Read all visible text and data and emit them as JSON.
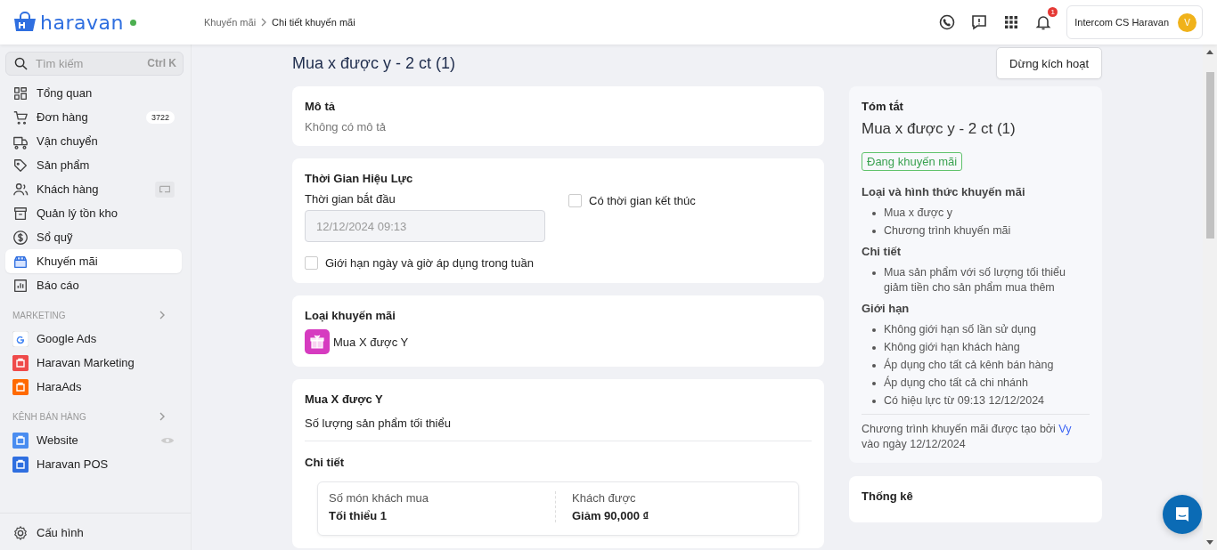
{
  "header": {
    "logo": "haravan",
    "breadcrumb": [
      {
        "label": "Khuyến mãi"
      },
      {
        "label": "Chi tiết khuyến mãi"
      }
    ],
    "notification_count": "1",
    "account": {
      "name": "Intercom CS Haravan",
      "initial": "V"
    }
  },
  "sidebar": {
    "search": {
      "placeholder": "Tìm kiếm",
      "shortcut": "Ctrl K"
    },
    "items": [
      {
        "label": "Tổng quan",
        "selected": false
      },
      {
        "label": "Đơn hàng",
        "selected": false,
        "badge": "3722"
      },
      {
        "label": "Vận chuyển",
        "selected": false
      },
      {
        "label": "Sản phẩm",
        "selected": false
      },
      {
        "label": "Khách hàng",
        "selected": false
      },
      {
        "label": "Quản lý tồn kho",
        "selected": false
      },
      {
        "label": "Sổ quỹ",
        "selected": false
      },
      {
        "label": "Khuyến mãi",
        "selected": true
      },
      {
        "label": "Báo cáo",
        "selected": false
      }
    ],
    "sections": [
      {
        "heading": "MARKETING",
        "items": [
          {
            "label": "Google Ads"
          },
          {
            "label": "Haravan Marketing"
          },
          {
            "label": "HaraAds"
          }
        ]
      },
      {
        "heading": "KÊNH BÁN HÀNG",
        "items": [
          {
            "label": "Website"
          },
          {
            "label": "Haravan POS"
          }
        ]
      }
    ],
    "footer_item": {
      "label": "Cấu hình"
    }
  },
  "page": {
    "title": "Mua x được y - 2 ct (1)",
    "action": "Dừng kích hoạt"
  },
  "description": {
    "title": "Mô tả",
    "text": "Không có mô tả"
  },
  "validity": {
    "title": "Thời Gian Hiệu Lực",
    "start_label": "Thời gian bắt đầu",
    "start_value": "12/12/2024 09:13",
    "start_disabled": true,
    "end_option": {
      "label": "Có thời gian kết thúc",
      "checked": false
    },
    "weekly_option": {
      "label": "Giới hạn ngày và giờ áp dụng trong tuần",
      "checked": false
    }
  },
  "promotion_type": {
    "title": "Loại khuyến mãi",
    "value": "Mua X được Y"
  },
  "rule": {
    "title": "Mua X được Y",
    "subtitle": "Số lượng sản phẩm tối thiểu",
    "detail_title": "Chi tiết",
    "columns": [
      {
        "label": "Số món khách mua",
        "value": "Tối thiểu 1"
      },
      {
        "label": "Khách được",
        "value": "Giảm 90,000 ₫"
      }
    ]
  },
  "summary": {
    "title": "Tóm tắt",
    "name": "Mua x được y - 2 ct (1)",
    "status": "Đang khuyến mãi",
    "sections": [
      {
        "heading": "Loại và hình thức khuyến mãi",
        "items": [
          "Mua x được y",
          "Chương trình khuyến mãi"
        ]
      },
      {
        "heading": "Chi tiết",
        "items": [
          "Mua sản phẩm với số lượng tối thiểu giảm tiền cho sản phẩm mua thêm"
        ]
      },
      {
        "heading": "Giới hạn",
        "items": [
          "Không giới hạn số lần sử dụng",
          "Không giới hạn khách hàng",
          "Áp dụng cho tất cả kênh bán hàng",
          "Áp dụng cho tất cả chi nhánh",
          "Có hiệu lực từ 09:13 12/12/2024"
        ]
      }
    ],
    "creator": {
      "before": "Chương trình khuyến mãi được tạo bởi",
      "link": "Vy",
      "after": "vào ngày 12/12/2024"
    }
  },
  "stats": {
    "title": "Thống kê"
  }
}
